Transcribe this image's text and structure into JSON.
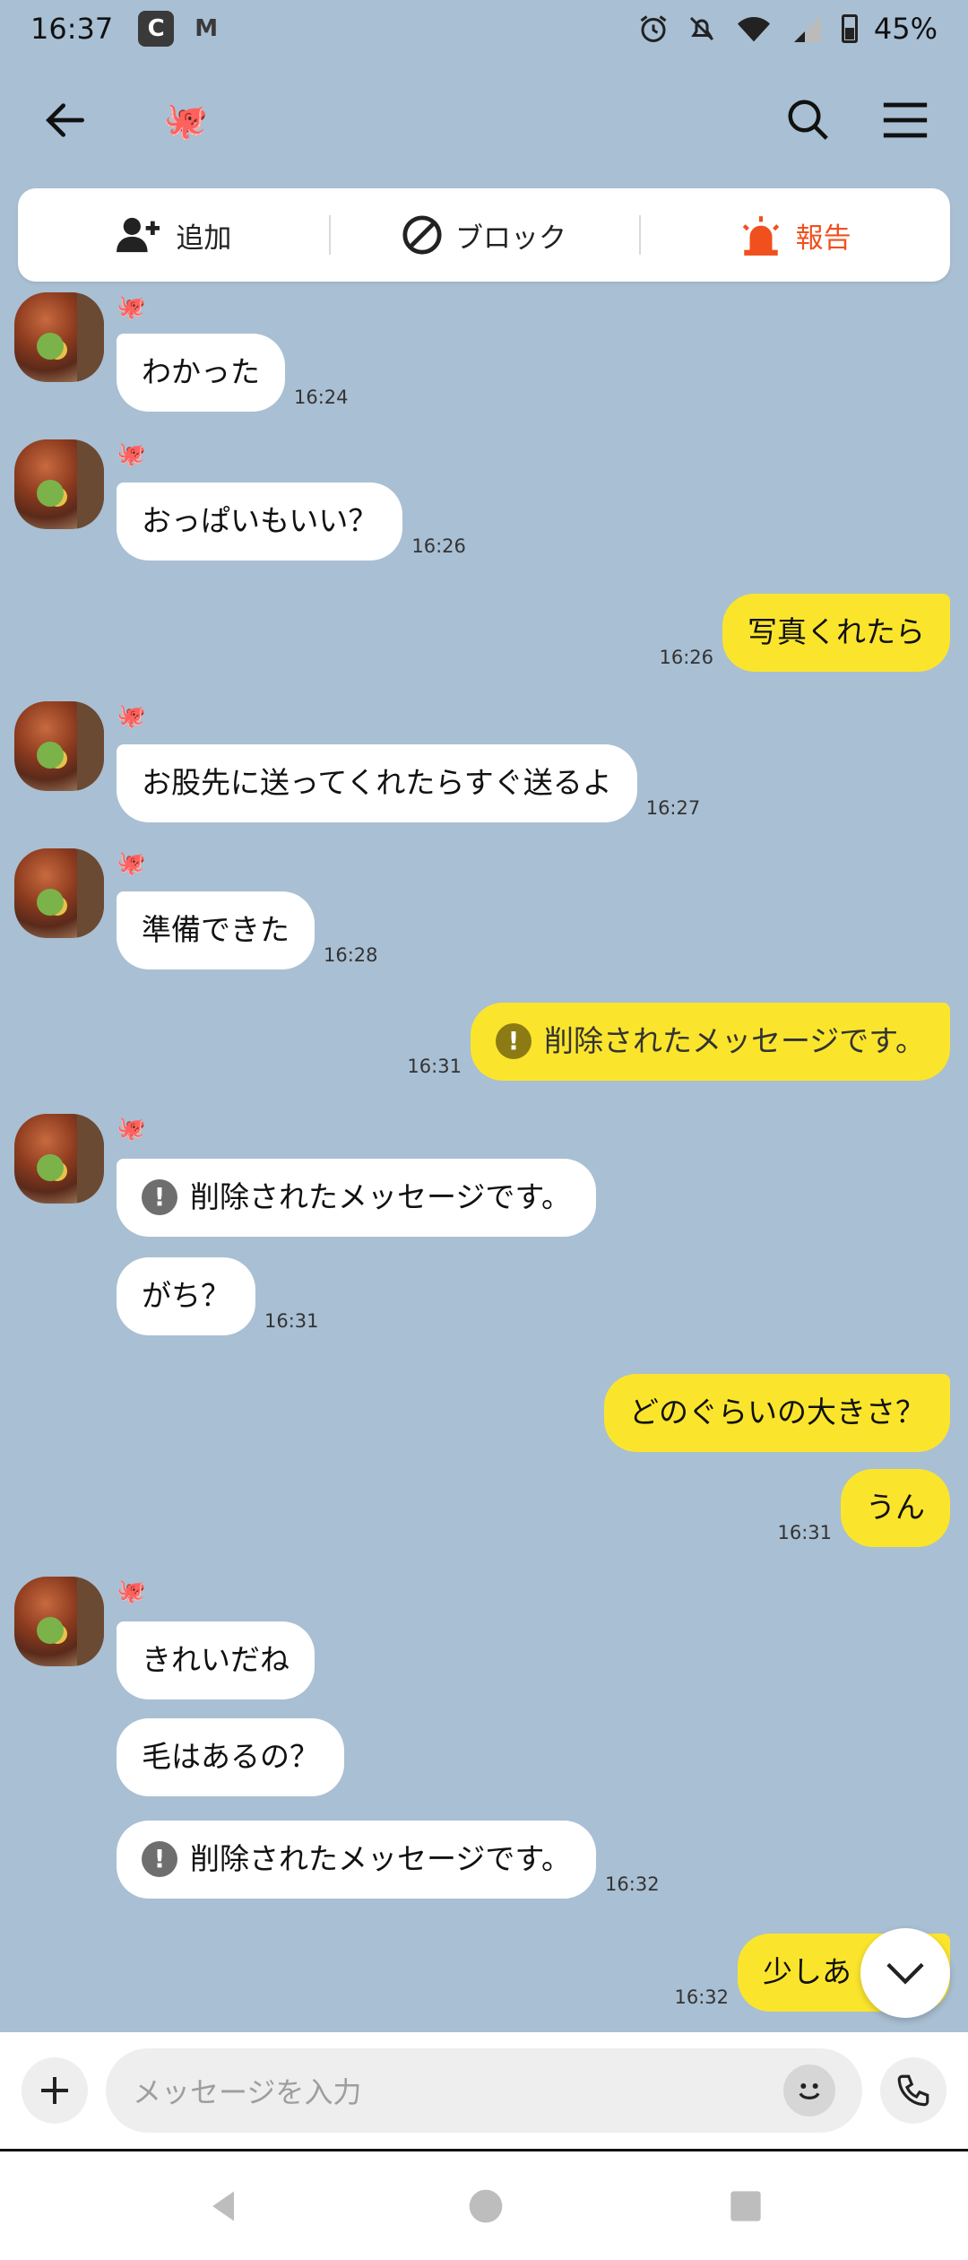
{
  "status_bar": {
    "time": "16:37",
    "app_icons": [
      "C",
      "M"
    ],
    "battery": "45%"
  },
  "header": {
    "chat_emoji": "🐙"
  },
  "actions": {
    "add": "追加",
    "block": "ブロック",
    "report": "報告"
  },
  "colors": {
    "background": "#a9bfd3",
    "my_bubble": "#fbe52c",
    "their_bubble": "#ffffff",
    "report": "#f0501e"
  },
  "sender_emoji": "🐙",
  "messages": [
    {
      "text": "わかった",
      "time": "16:24"
    },
    {
      "text": "おっぱいもいい？",
      "time": "16:26"
    },
    {
      "text": "写真くれたら",
      "time": "16:26"
    },
    {
      "text": "お股先に送ってくれたらすぐ送るよ",
      "time": "16:27"
    },
    {
      "text": "準備できた",
      "time": "16:28"
    },
    {
      "text": "削除されたメッセージです。",
      "time": "16:31"
    },
    {
      "text": "削除されたメッセージです。",
      "time": ""
    },
    {
      "text": "がち？",
      "time": "16:31"
    },
    {
      "text": "どのぐらいの大きさ？",
      "time": ""
    },
    {
      "text": "うん",
      "time": "16:31"
    },
    {
      "text": "きれいだね",
      "time": ""
    },
    {
      "text": "毛はあるの？",
      "time": ""
    },
    {
      "text": "削除されたメッセージです。",
      "time": "16:32"
    },
    {
      "text": "少しあ",
      "time": "16:32"
    }
  ],
  "input": {
    "placeholder": "メッセージを入力"
  }
}
